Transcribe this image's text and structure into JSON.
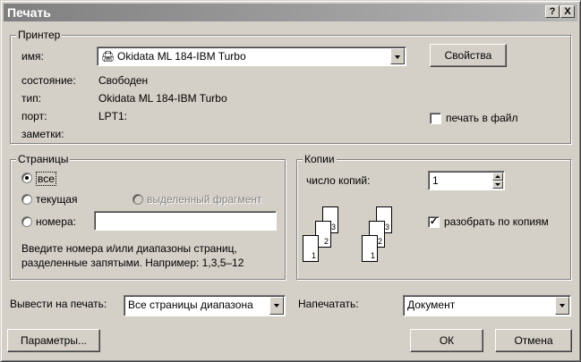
{
  "window": {
    "title": "Печать",
    "help_button": "?",
    "close_button": "X"
  },
  "printer": {
    "legend": "Принтер",
    "name_label": "имя:",
    "name_value": "Okidata ML 184-IBM Turbo",
    "properties_button": "Свойства",
    "status_label": "состояние:",
    "status_value": "Свободен",
    "type_label": "тип:",
    "type_value": "Okidata ML 184-IBM Turbo",
    "port_label": "порт:",
    "port_value": "LPT1:",
    "notes_label": "заметки:",
    "print_to_file_label": "печать в файл",
    "print_to_file_checked": false
  },
  "pages": {
    "legend": "Страницы",
    "all_label": "все",
    "current_label": "текущая",
    "selection_label": "выделенный фрагмент",
    "numbers_label": "номера:",
    "numbers_value": "",
    "selected": "all",
    "hint_line1": "Введите номера и/или диапазоны страниц,",
    "hint_line2": "разделенные запятыми. Например: 1,3,5–12"
  },
  "copies": {
    "legend": "Копии",
    "count_label": "число копий:",
    "count_value": "1",
    "collate_label": "разобрать по копиям",
    "collate_checked": true,
    "page_numbers": [
      "1",
      "2",
      "3"
    ],
    "check_mark": "✓"
  },
  "bottom": {
    "print_what_label": "Вывести на печать:",
    "print_what_value": "Все страницы диапазона",
    "print_label": "Напечатать:",
    "print_value": "Документ",
    "options_button": "Параметры...",
    "ok_button": "ОК",
    "cancel_button": "Отмена"
  }
}
